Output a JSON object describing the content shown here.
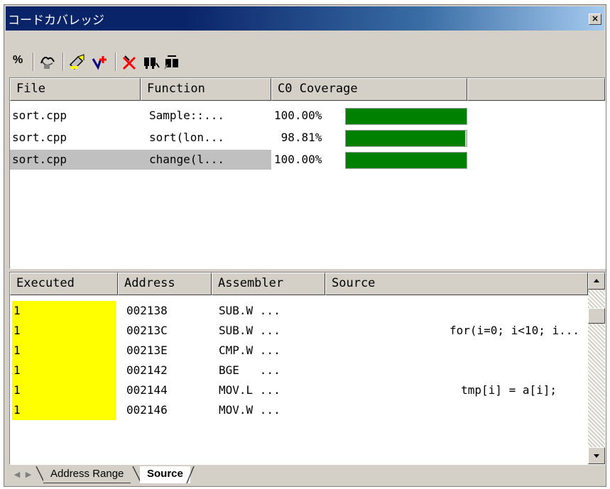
{
  "window": {
    "title": "コードカバレッジ",
    "close_label": "×"
  },
  "toolbar": {
    "percent_label": "%",
    "icons": [
      "percent-icon",
      "coverage-range-icon",
      "clear-icon",
      "add-range-icon",
      "delete-icon",
      "find-icon",
      "goto-source-icon"
    ]
  },
  "upper": {
    "headers": [
      "File",
      "Function",
      "C0 Coverage"
    ],
    "rows": [
      {
        "file": "sort.cpp",
        "function": "Sample::...",
        "coverage": "100.00%",
        "fraction": 1.0,
        "selected": false
      },
      {
        "file": "sort.cpp",
        "function": "sort(lon...",
        "coverage": " 98.81%",
        "fraction": 0.9881,
        "selected": false
      },
      {
        "file": "sort.cpp",
        "function": "change(l...",
        "coverage": "100.00%",
        "fraction": 1.0,
        "selected": true
      }
    ]
  },
  "lower": {
    "headers": [
      "Executed",
      "Address",
      "Assembler",
      "Source"
    ],
    "rows": [
      {
        "executed": "1",
        "address": "002138",
        "assembler": "SUB.W ...",
        "source": ""
      },
      {
        "executed": "1",
        "address": "00213C",
        "assembler": "SUB.W ...",
        "source": "for(i=0; i<10; i..."
      },
      {
        "executed": "1",
        "address": "00213E",
        "assembler": "CMP.W ...",
        "source": ""
      },
      {
        "executed": "1",
        "address": "002142",
        "assembler": "BGE   ...",
        "source": ""
      },
      {
        "executed": "1",
        "address": "002144",
        "assembler": "MOV.L ...",
        "source": "tmp[i] = a[i];"
      },
      {
        "executed": "1",
        "address": "002146",
        "assembler": "MOV.W ...",
        "source": ""
      }
    ]
  },
  "tabs": [
    {
      "label": "Address Range",
      "active": false
    },
    {
      "label": "Source",
      "active": true
    }
  ],
  "colors": {
    "coverage_fill": "#008000",
    "executed_highlight": "#ffff00",
    "title_start": "#0a246a"
  }
}
